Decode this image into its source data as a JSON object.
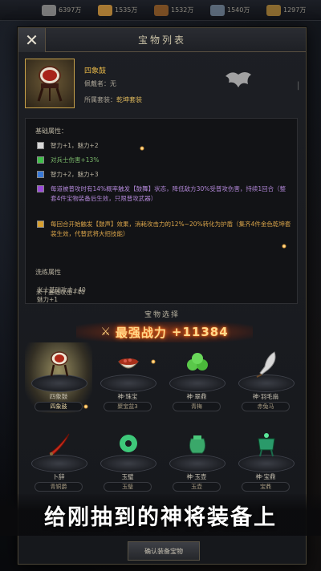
{
  "topbar": {
    "resources": [
      {
        "icon": "gold-coin-icon",
        "value": "6397万",
        "color": "#8a8a8a"
      },
      {
        "icon": "grain-icon",
        "value": "1535万",
        "color": "#b88a3a"
      },
      {
        "icon": "wood-icon",
        "value": "1532万",
        "color": "#8a5a2a"
      },
      {
        "icon": "iron-icon",
        "value": "1540万",
        "color": "#6a7a8a"
      },
      {
        "icon": "horse-icon",
        "value": "1297万",
        "color": "#9a7a3a"
      }
    ]
  },
  "panel": {
    "title": "宝物列表",
    "close_label": "✕"
  },
  "item": {
    "name": "四象鼓",
    "holder": "佩戴者：无",
    "set_label": "所属套装：",
    "set_name": "乾坤套装"
  },
  "attributes": {
    "title": "基础属性：",
    "rows": [
      {
        "color": "#d8d8d8",
        "text": "智力+1，魅力+2",
        "tone": ""
      },
      {
        "color": "#3fbf4a",
        "text": "对兵士伤害+13%",
        "tone": "green"
      },
      {
        "color": "#3a7ad8",
        "text": "智力+2，魅力+3",
        "tone": ""
      },
      {
        "color": "#9a4ad8",
        "text": "每道被普攻时有14%概率触发【鼓舞】状态，降低敌方30%受普攻伤害，持续1回合（整套4件宝物装备后生效，只限普攻武器）",
        "tone": "purple"
      },
      {
        "color": "#d8a030",
        "text": "每回合开始触发【鼓声】效果，消耗攻击力的12%~20%转化为护盾（集齐4件金色乾坤套装生效，代替武将大招技能）",
        "tone": "orange"
      }
    ],
    "suit_title": "洗练属性",
    "suit_lines": [
      "米十基础攻击+40",
      "魅力+1",
      "米十基础攻击+40"
    ]
  },
  "selection": {
    "title": "宝物选择",
    "power_label": "最强战力",
    "power_value": "+11384",
    "items": [
      {
        "name": "四象鼓",
        "owner": "四象鼓",
        "icon": "drum-icon",
        "selected": true
      },
      {
        "name": "神·珠宝",
        "owner": "聚宝盆3",
        "icon": "bowl-icon",
        "selected": false
      },
      {
        "name": "神·翠鼎",
        "owner": "青梅",
        "icon": "jade-cluster-icon",
        "selected": false
      },
      {
        "name": "神·羽毛扇",
        "owner": "赤兔马",
        "icon": "feather-fan-icon",
        "selected": false
      },
      {
        "name": "卜辞",
        "owner": "青铜爵",
        "icon": "red-blade-icon",
        "selected": false
      },
      {
        "name": "玉璧",
        "owner": "玉璧",
        "icon": "jade-disc-icon",
        "selected": false
      },
      {
        "name": "神·玉壶",
        "owner": "玉壶",
        "icon": "jade-pot-icon",
        "selected": false
      },
      {
        "name": "神·宝鼎",
        "owner": "宝鼎",
        "icon": "jade-tripod-icon",
        "selected": false
      }
    ],
    "bottom_button": "确认装备宝物"
  },
  "caption": "给刚抽到的神将装备上"
}
